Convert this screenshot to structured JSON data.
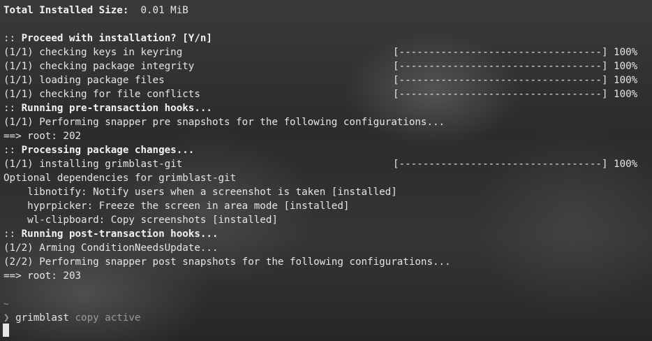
{
  "lines": {
    "total_size_label": "Total Installed Size:",
    "total_size_value": "0.01 MiB",
    "proceed_prefix": "::",
    "proceed_text": "Proceed with installation? [Y/n]",
    "step1": "(1/1) checking keys in keyring",
    "step1_bar": "[----------------------------------] 100%",
    "step2": "(1/1) checking package integrity",
    "step2_bar": "[----------------------------------] 100%",
    "step3": "(1/1) loading package files",
    "step3_bar": "[----------------------------------] 100%",
    "step4": "(1/1) checking for file conflicts",
    "step4_bar": "[----------------------------------] 100%",
    "pre_hooks_prefix": "::",
    "pre_hooks_text": "Running pre-transaction hooks...",
    "snapper_pre": "(1/1) Performing snapper pre snapshots for the following configurations...",
    "root_pre": "==> root: 202",
    "processing_prefix": "::",
    "processing_text": "Processing package changes...",
    "installing": "(1/1) installing grimblast-git",
    "installing_bar": "[----------------------------------] 100%",
    "optional_deps": "Optional dependencies for grimblast-git",
    "dep1": "    libnotify: Notify users when a screenshot is taken [installed]",
    "dep2": "    hyprpicker: Freeze the screen in area mode [installed]",
    "dep3": "    wl-clipboard: Copy screenshots [installed]",
    "post_hooks_prefix": "::",
    "post_hooks_text": "Running post-transaction hooks...",
    "arming": "(1/2) Arming ConditionNeedsUpdate...",
    "snapper_post": "(2/2) Performing snapper post snapshots for the following configurations...",
    "root_post": "==> root: 203",
    "cwd": "~",
    "prompt_symbol": "❯",
    "command_name": "grimblast",
    "command_args": " copy active"
  }
}
